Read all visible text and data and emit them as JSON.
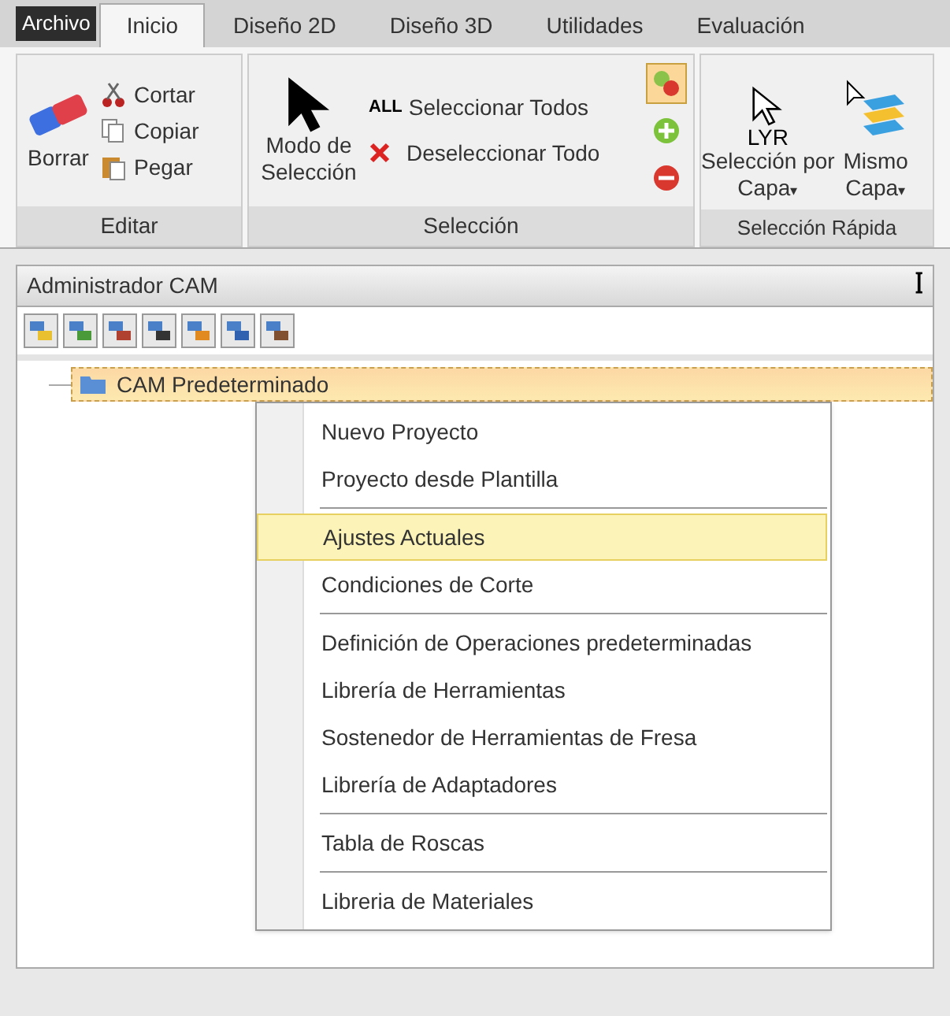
{
  "tabs": [
    {
      "label": "Archivo",
      "kind": "file",
      "selected": false
    },
    {
      "label": "Inicio",
      "kind": "tab",
      "selected": true
    },
    {
      "label": "Diseño 2D",
      "kind": "tab",
      "selected": false
    },
    {
      "label": "Diseño 3D",
      "kind": "tab",
      "selected": false
    },
    {
      "label": "Utilidades",
      "kind": "tab",
      "selected": false
    },
    {
      "label": "Evaluación",
      "kind": "tab",
      "selected": false
    }
  ],
  "ribbon": {
    "editar": {
      "title": "Editar",
      "big": "Borrar",
      "small": [
        "Cortar",
        "Copiar",
        "Pegar"
      ]
    },
    "seleccion": {
      "title": "Selección",
      "big": "Modo de Selección",
      "small": [
        {
          "badge": "ALL",
          "label": "Seleccionar Todos"
        },
        {
          "label": "Deseleccionar Todo"
        }
      ],
      "modes": [
        {
          "kind": "mixed",
          "selected": true
        },
        {
          "kind": "add",
          "selected": false
        },
        {
          "kind": "remove",
          "selected": false
        }
      ]
    },
    "rapida": {
      "title": "Selección Rápida",
      "buttons": [
        {
          "badge": "LYR",
          "label": "Selección por Capa",
          "caret": "▾"
        },
        {
          "label": "Mismo Capa",
          "caret": "▾"
        }
      ]
    }
  },
  "panel": {
    "title": "Administrador CAM",
    "pin": "ꟾ",
    "tree_item": {
      "label": "CAM Predeterminado",
      "selected": true
    }
  },
  "menu": {
    "groups": [
      [
        {
          "label": "Nuevo Proyecto",
          "selected": false
        },
        {
          "label": "Proyecto desde Plantilla",
          "selected": false
        }
      ],
      [
        {
          "label": "Ajustes Actuales",
          "selected": true
        },
        {
          "label": "Condiciones de Corte",
          "selected": false
        }
      ],
      [
        {
          "label": "Definición de Operaciones predeterminadas",
          "selected": false
        },
        {
          "label": "Librería de Herramientas",
          "selected": false
        },
        {
          "label": "Sostenedor de Herramientas de Fresa",
          "selected": false
        },
        {
          "label": "Librería de Adaptadores",
          "selected": false
        }
      ],
      [
        {
          "label": "Tabla de Roscas",
          "selected": false
        }
      ],
      [
        {
          "label": "Libreria de Materiales",
          "selected": false
        }
      ]
    ]
  }
}
